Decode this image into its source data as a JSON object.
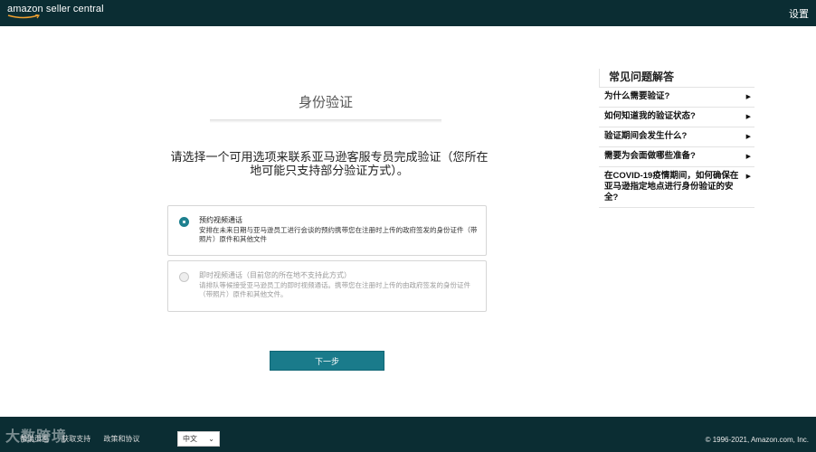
{
  "header": {
    "logo_text": "amazon seller central",
    "settings_label": "设置"
  },
  "main": {
    "title": "身份验证",
    "instructions": "请选择一个可用选项来联系亚马逊客服专员完成验证（您所在地可能只支持部分验证方式）。",
    "options": [
      {
        "title": "预约视频通话",
        "description": "安排在未来日期与亚马逊员工进行会谈的预约携带您在注册时上传的政府签发的身份证件（带照片）原件和其他文件",
        "selected": true
      },
      {
        "title": "即时视频通话（目前您的所在地不支持此方式）",
        "description": "请排队等候接受亚马逊员工的即时视频通话。携带您在注册时上传的由政府签发的身份证件（带照片）原件和其他文件。",
        "selected": false
      }
    ],
    "next_button": "下一步"
  },
  "faq": {
    "heading": "常见问题解答",
    "items": [
      "为什么需要验证?",
      "如何知道我的验证状态?",
      "验证期间会发生什么?",
      "需要为会面做哪些准备?",
      "在COVID-19疫情期间，如何确保在亚马逊指定地点进行身份验证的安全?"
    ],
    "arrow_icon": "▶"
  },
  "footer": {
    "links": [
      "帮助页面",
      "获取支持",
      "政策和协议"
    ],
    "language": "中文",
    "copyright": "© 1996-2021, Amazon.com, Inc.",
    "watermark": "大数跨境"
  },
  "colors": {
    "topbar": "#0b2d33",
    "accent": "#1a7b8b"
  }
}
